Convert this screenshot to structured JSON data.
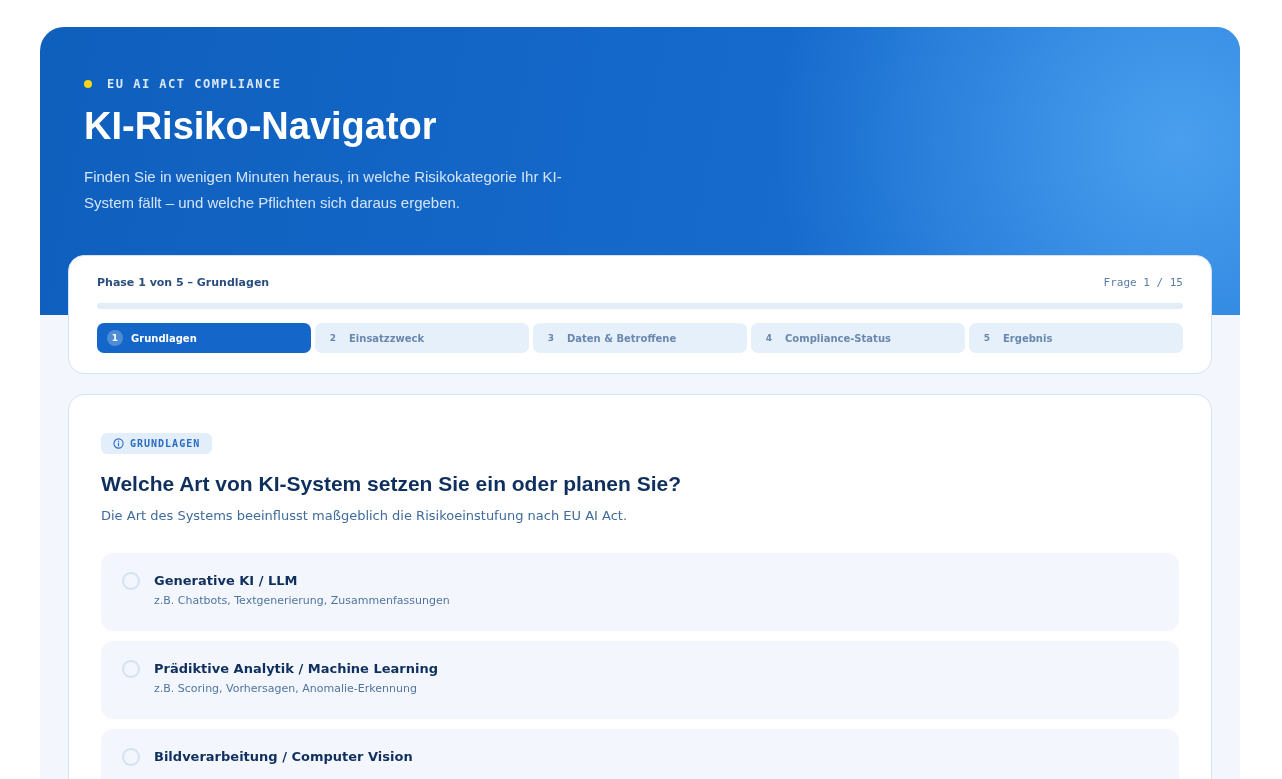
{
  "header": {
    "eyebrow": "EU AI ACT COMPLIANCE",
    "title": "KI-Risiko-Navigator",
    "subtitle": "Finden Sie in wenigen Minuten heraus, in welche Risikokategorie Ihr KI-System fällt – und welche Pflichten sich daraus ergeben."
  },
  "progress": {
    "phase_label": "Phase 1 von 5 – Grundlagen",
    "counter": "Frage 1 / 15",
    "steps": [
      {
        "number": "1",
        "label": "Grundlagen",
        "selected": true
      },
      {
        "number": "2",
        "label": "Einsatzzweck",
        "selected": false
      },
      {
        "number": "3",
        "label": "Daten & Betroffene",
        "selected": false
      },
      {
        "number": "4",
        "label": "Compliance-Status",
        "selected": false
      },
      {
        "number": "5",
        "label": "Ergebnis",
        "selected": false
      }
    ]
  },
  "question": {
    "tag": "GRUNDLAGEN",
    "title": "Welche Art von KI-System setzen Sie ein oder planen Sie?",
    "hint": "Die Art des Systems beeinflusst maßgeblich die Risikoeinstufung nach EU AI Act.",
    "options": [
      {
        "label": "Generative KI / LLM",
        "example": "z.B. Chatbots, Textgenerierung, Zusammenfassungen",
        "selected": false
      },
      {
        "label": "Prädiktive Analytik / Machine Learning",
        "example": "z.B. Scoring, Vorhersagen, Anomalie-Erkennung",
        "selected": false
      },
      {
        "label": "Bildverarbeitung / Computer Vision",
        "selected": false
      }
    ]
  }
}
